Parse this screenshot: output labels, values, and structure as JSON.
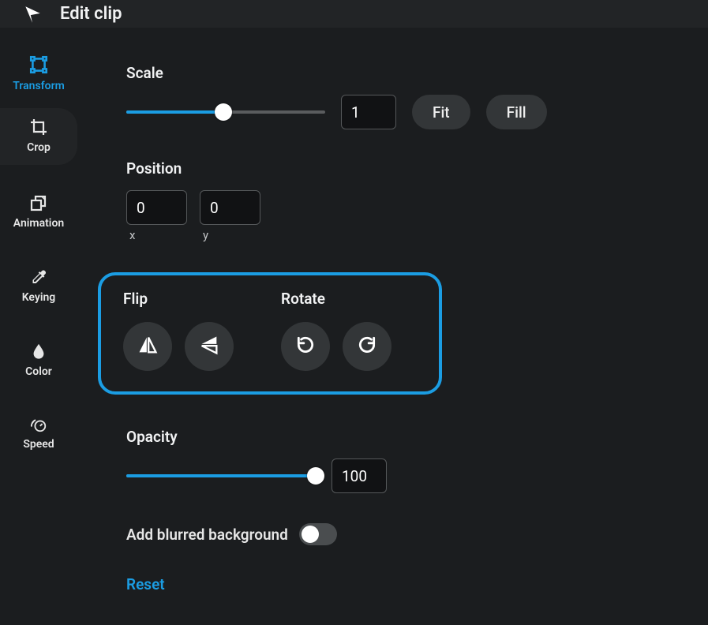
{
  "topbar": {
    "title": "Edit clip"
  },
  "sidebar": {
    "items": [
      {
        "label": "Transform"
      },
      {
        "label": "Crop"
      },
      {
        "label": "Animation"
      },
      {
        "label": "Keying"
      },
      {
        "label": "Color"
      },
      {
        "label": "Speed"
      }
    ]
  },
  "scale": {
    "label": "Scale",
    "value": "1",
    "fit_label": "Fit",
    "fill_label": "Fill",
    "slider_fill_pct": 49
  },
  "position": {
    "label": "Position",
    "x_value": "0",
    "y_value": "0",
    "x_label": "x",
    "y_label": "y"
  },
  "flip": {
    "label": "Flip"
  },
  "rotate": {
    "label": "Rotate"
  },
  "opacity": {
    "label": "Opacity",
    "value": "100",
    "slider_fill_pct": 100
  },
  "blur": {
    "label": "Add blurred background",
    "enabled": false
  },
  "reset": {
    "label": "Reset"
  }
}
